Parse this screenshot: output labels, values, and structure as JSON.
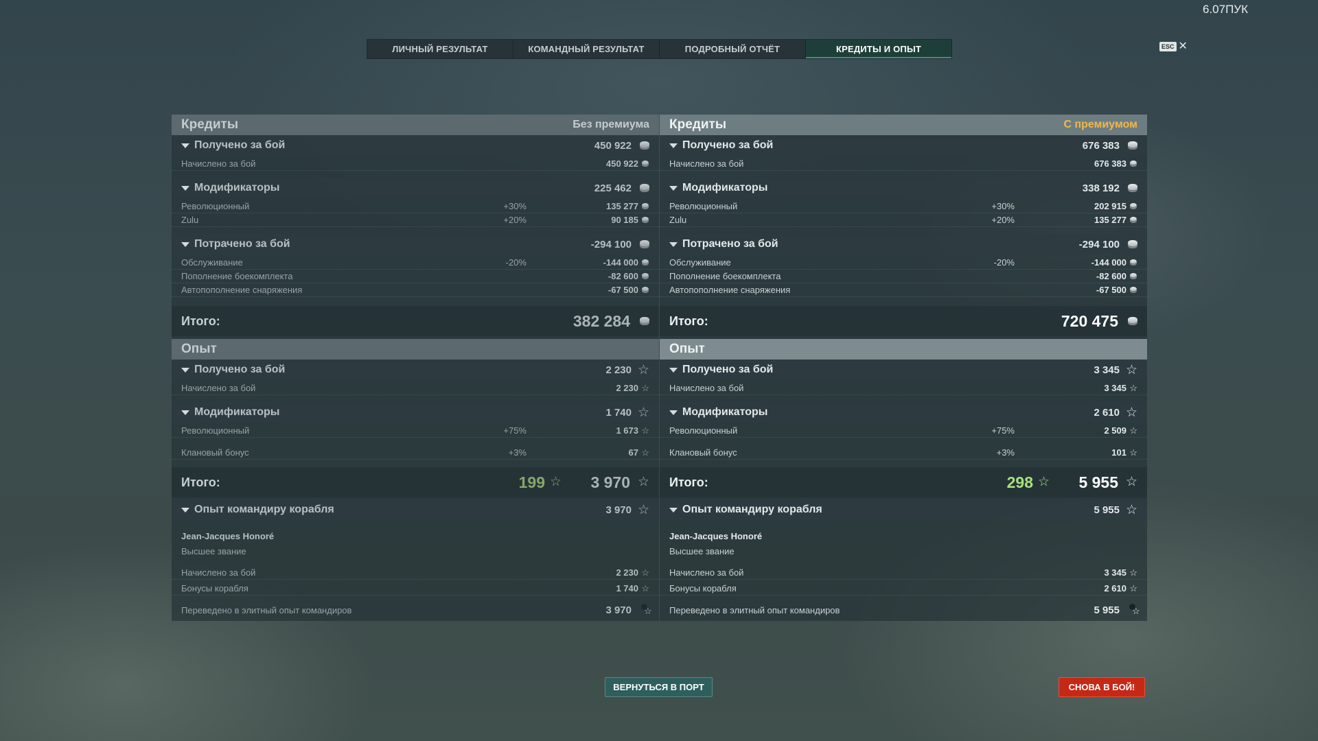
{
  "version": "6.07ПУК",
  "tabs": [
    "ЛИЧНЫЙ РЕЗУЛЬТАТ",
    "КОМАНДНЫЙ РЕЗУЛЬТАТ",
    "ПОДРОБНЫЙ ОТЧЁТ",
    "КРЕДИТЫ И ОПЫТ"
  ],
  "active_tab": 3,
  "esc": {
    "key": "ESC",
    "close": "✕"
  },
  "columns": [
    {
      "credits_header": "Кредиты",
      "mode": "Без премиума",
      "earned": {
        "label": "Получено за бой",
        "value": "450 922"
      },
      "earned_items": [
        {
          "label": "Начислено за бой",
          "value": "450 922"
        }
      ],
      "modifiers": {
        "label": "Модификаторы",
        "value": "225 462"
      },
      "modifier_items": [
        {
          "label": "Революционный",
          "pct": "+30%",
          "value": "135 277"
        },
        {
          "label": "Zulu",
          "pct": "+20%",
          "value": "90 185"
        }
      ],
      "spent": {
        "label": "Потрачено за бой",
        "value": "-294 100"
      },
      "spent_items": [
        {
          "label": "Обслуживание",
          "pct": "-20%",
          "value": "-144 000"
        },
        {
          "label": "Пополнение боекомплекта",
          "pct": "",
          "value": "-82 600"
        },
        {
          "label": "Автопополнение снаряжения",
          "pct": "",
          "value": "-67 500"
        }
      ],
      "credits_total": {
        "label": "Итого:",
        "value": "382 284"
      },
      "xp_header": "Опыт",
      "xp_earned": {
        "label": "Получено за бой",
        "value": "2 230"
      },
      "xp_earned_items": [
        {
          "label": "Начислено за бой",
          "value": "2 230"
        }
      ],
      "xp_modifiers": {
        "label": "Модификаторы",
        "value": "1 740"
      },
      "xp_modifier_items": [
        {
          "label": "Революционный",
          "pct": "+75%",
          "value": "1 673"
        },
        {
          "label": "Клановый бонус",
          "pct": "+3%",
          "value": "67"
        }
      ],
      "xp_total": {
        "label": "Итого:",
        "free": "199",
        "value": "3 970"
      },
      "commander": {
        "label": "Опыт командиру корабля",
        "value": "3 970"
      },
      "commander_name": "Jean-Jacques Honoré",
      "commander_rank": "Высшее звание",
      "commander_items": [
        {
          "label": "Начислено за бой",
          "value": "2 230"
        },
        {
          "label": "Бонусы корабля",
          "value": "1 740"
        }
      ],
      "elite": {
        "label": "Переведено в элитный опыт командиров",
        "value": "3 970"
      }
    },
    {
      "credits_header": "Кредиты",
      "mode": "С премиумом",
      "earned": {
        "label": "Получено за бой",
        "value": "676 383"
      },
      "earned_items": [
        {
          "label": "Начислено за бой",
          "value": "676 383"
        }
      ],
      "modifiers": {
        "label": "Модификаторы",
        "value": "338 192"
      },
      "modifier_items": [
        {
          "label": "Революционный",
          "pct": "+30%",
          "value": "202 915"
        },
        {
          "label": "Zulu",
          "pct": "+20%",
          "value": "135 277"
        }
      ],
      "spent": {
        "label": "Потрачено за бой",
        "value": "-294 100"
      },
      "spent_items": [
        {
          "label": "Обслуживание",
          "pct": "-20%",
          "value": "-144 000"
        },
        {
          "label": "Пополнение боекомплекта",
          "pct": "",
          "value": "-82 600"
        },
        {
          "label": "Автопополнение снаряжения",
          "pct": "",
          "value": "-67 500"
        }
      ],
      "credits_total": {
        "label": "Итого:",
        "value": "720 475"
      },
      "xp_header": "Опыт",
      "xp_earned": {
        "label": "Получено за бой",
        "value": "3 345"
      },
      "xp_earned_items": [
        {
          "label": "Начислено за бой",
          "value": "3 345"
        }
      ],
      "xp_modifiers": {
        "label": "Модификаторы",
        "value": "2 610"
      },
      "xp_modifier_items": [
        {
          "label": "Революционный",
          "pct": "+75%",
          "value": "2 509"
        },
        {
          "label": "Клановый бонус",
          "pct": "+3%",
          "value": "101"
        }
      ],
      "xp_total": {
        "label": "Итого:",
        "free": "298",
        "value": "5 955"
      },
      "commander": {
        "label": "Опыт командиру корабля",
        "value": "5 955"
      },
      "commander_name": "Jean-Jacques Honoré",
      "commander_rank": "Высшее звание",
      "commander_items": [
        {
          "label": "Начислено за бой",
          "value": "3 345"
        },
        {
          "label": "Бонусы корабля",
          "value": "2 610"
        }
      ],
      "elite": {
        "label": "Переведено в элитный опыт командиров",
        "value": "5 955"
      }
    }
  ],
  "buttons": {
    "to_port": "ВЕРНУТЬСЯ В ПОРТ",
    "battle": "СНОВА В БОЙ!"
  },
  "colors": {
    "premium": "#f2b846",
    "free_xp": "#a8e07c",
    "battle_button": "#c52915",
    "port_button": "#2f5e5e",
    "active_tab": "#1e3e3a"
  },
  "icons": {
    "credits": "credits-icon",
    "xp": "xp-star-icon",
    "elite_xp": "elite-commander-xp-icon",
    "expand": "triangle-down-icon"
  }
}
